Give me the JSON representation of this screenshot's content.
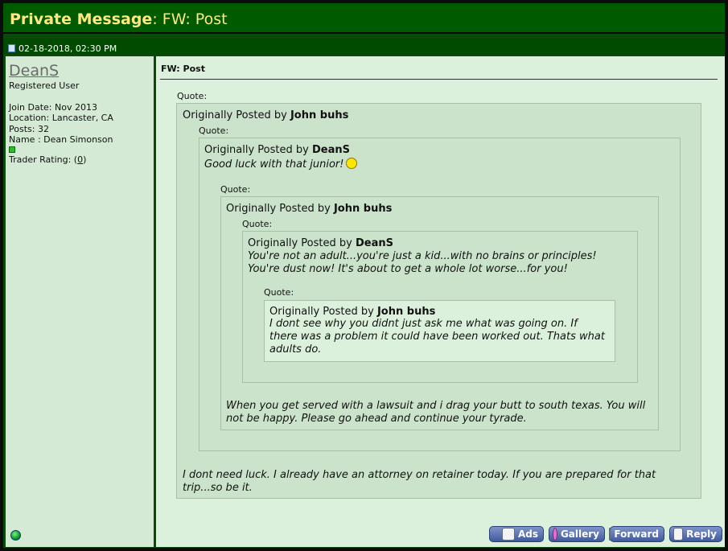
{
  "header": {
    "title_prefix": "Private Message",
    "title_subject": ": FW: Post"
  },
  "post": {
    "date": "02-18-2018, 02:30 PM",
    "subject": "FW: Post"
  },
  "user": {
    "name": "DeanS",
    "title": "Registered User",
    "join_date": "Join Date: Nov 2013",
    "location": "Location: Lancaster, CA",
    "posts": "Posts: 32",
    "real_name": "Name : Dean Simonson",
    "trader_label": "Trader Rating: (",
    "trader_value": "0",
    "trader_close": ")"
  },
  "quote_label": "Quote:",
  "posted_by_prefix": "Originally Posted by ",
  "quotes": {
    "q1": {
      "author": "John buhs",
      "reply": [
        "I dont need luck. I already have an attorney on retainer today. If you are prepared for that",
        "trip...so be it."
      ]
    },
    "q2": {
      "author": "DeanS",
      "text": "Good luck with that junior!"
    },
    "q3": {
      "author": "John buhs",
      "reply": [
        "When you get served with a lawsuit and i drag your butt to south texas. You will",
        "not be happy. Please go ahead and continue your tyrade."
      ]
    },
    "q4": {
      "author": "DeanS",
      "lines": [
        "You're not an adult...you're just a kid...with no brains or principles!",
        "You're dust now! It's about to get a whole lot worse...for you!"
      ]
    },
    "q5": {
      "author": "John buhs",
      "lines": [
        "I dont see why you didnt just ask me what was going on. If",
        "there was a problem it could have been worked out. Thats what",
        "adults do."
      ]
    }
  },
  "buttons": {
    "ads": "Ads",
    "gallery": "Gallery",
    "forward": "Forward",
    "reply": "Reply"
  },
  "colors": {
    "title_text": "#ffe97f",
    "header_bg": "#005a00",
    "quote_bg": "#cbe3cb",
    "panel_bg": "#dcf1dc"
  }
}
